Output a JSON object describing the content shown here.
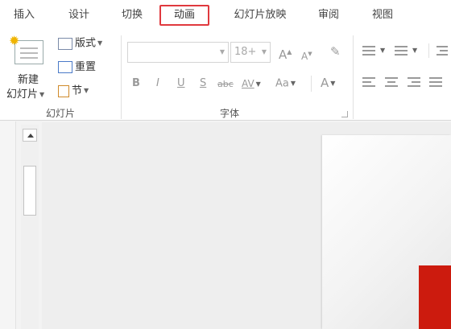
{
  "tabs": [
    {
      "label": "插入"
    },
    {
      "label": "设计"
    },
    {
      "label": "切换"
    },
    {
      "label": "动画"
    },
    {
      "label": "幻灯片放映"
    },
    {
      "label": "审阅"
    },
    {
      "label": "视图"
    }
  ],
  "active_tab": "动画",
  "ribbon": {
    "slides_group": {
      "label": "幻灯片",
      "new_slide_line1": "新建",
      "new_slide_line2": "幻灯片",
      "layout_label": "版式",
      "reset_label": "重置",
      "section_label": "节"
    },
    "font_group": {
      "label": "字体",
      "font_name_value": "",
      "font_size_value": "18+",
      "increase_font": "A",
      "decrease_font": "A",
      "bold": "B",
      "italic": "I",
      "underline": "U",
      "shadow": "S",
      "strikethrough": "abc",
      "char_spacing": "AV",
      "change_case": "Aa",
      "font_color": "A"
    }
  },
  "colors": {
    "active_tab_border": "#e0393e",
    "slide_accent": "#cc1b0e"
  }
}
